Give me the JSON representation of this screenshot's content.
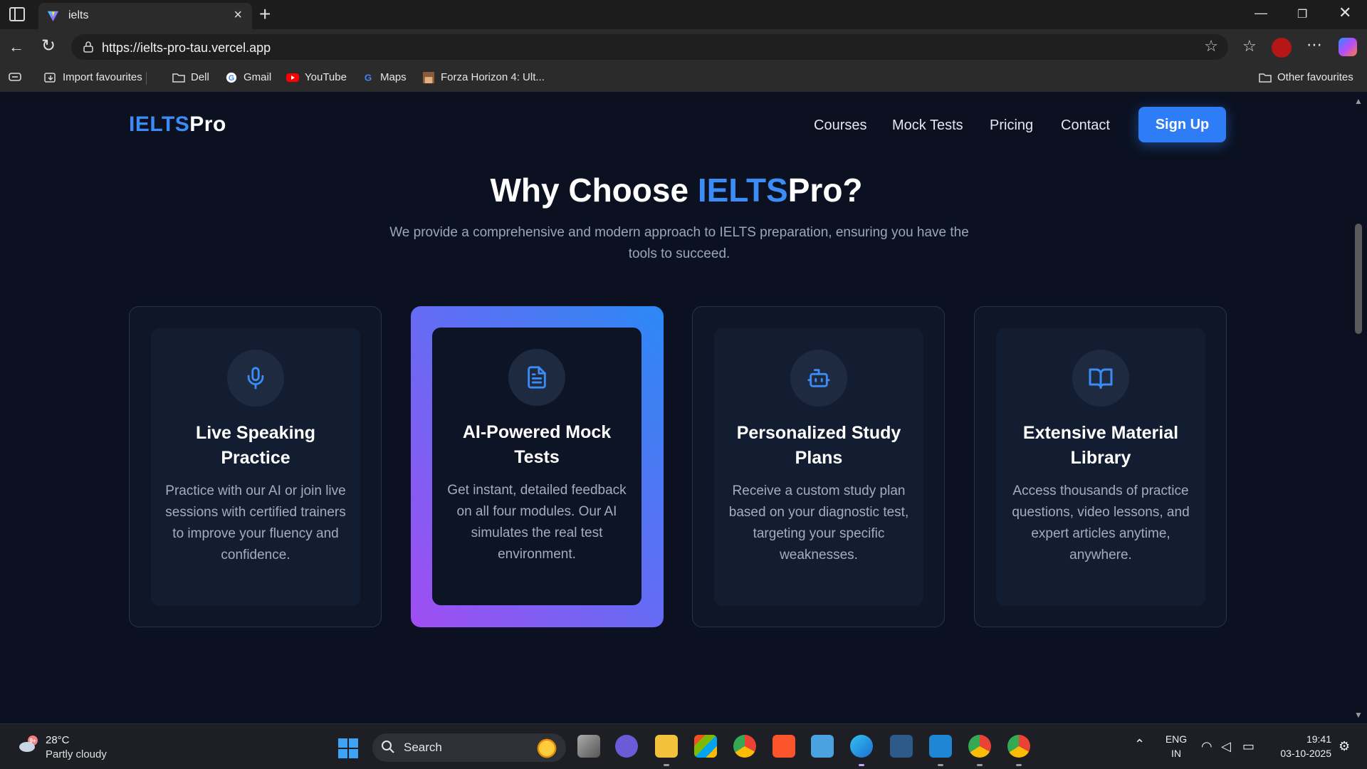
{
  "browser": {
    "tab_title": "ielts",
    "url": "https://ielts-pro-tau.vercel.app",
    "bookmarks": [
      "Import favourites",
      "Dell",
      "Gmail",
      "YouTube",
      "Maps",
      "Forza Horizon 4: Ult..."
    ],
    "other_favourites": "Other favourites"
  },
  "site": {
    "logo_part1": "IELTS",
    "logo_part2": "Pro",
    "nav": [
      "Courses",
      "Mock Tests",
      "Pricing",
      "Contact"
    ],
    "signup_label": "Sign Up",
    "headline_part1": "Why Choose ",
    "headline_part2": "IELTS",
    "headline_part3": "Pro?",
    "subtitle": "We provide a comprehensive and modern approach to IELTS preparation, ensuring you have the tools to succeed.",
    "features": [
      {
        "icon": "microphone-icon",
        "title": "Live Speaking Practice",
        "description": "Practice with our AI or join live sessions with certified trainers to improve your fluency and confidence.",
        "featured": false
      },
      {
        "icon": "document-icon",
        "title": "AI-Powered Mock Tests",
        "description": "Get instant, detailed feedback on all four modules. Our AI simulates the real test environment.",
        "featured": true
      },
      {
        "icon": "robot-icon",
        "title": "Personalized Study Plans",
        "description": "Receive a custom study plan based on your diagnostic test, targeting your specific weaknesses.",
        "featured": false
      },
      {
        "icon": "book-icon",
        "title": "Extensive Material Library",
        "description": "Access thousands of practice questions, video lessons, and expert articles anytime, anywhere.",
        "featured": false
      }
    ]
  },
  "taskbar": {
    "weather_temp": "28°C",
    "weather_desc": "Partly cloudy",
    "weather_badge": "9+",
    "search_label": "Search",
    "lang_line1": "ENG",
    "lang_line2": "IN",
    "time": "19:41",
    "date": "03-10-2025"
  },
  "colors": {
    "accent": "#3b8cf6",
    "page_bg": "#0b1120",
    "card_gradient_start": "#a04df2",
    "card_gradient_end": "#2b89f5"
  }
}
